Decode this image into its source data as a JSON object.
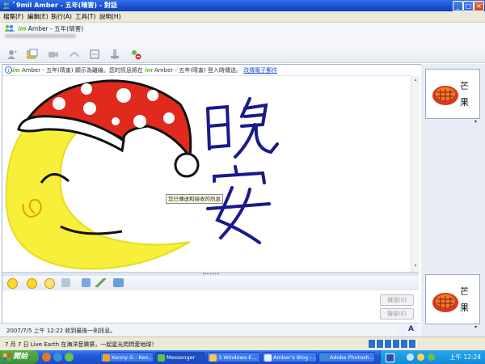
{
  "window": {
    "title": "ﾟ9mil Amber - 五年(晴害) - 對話",
    "controls": [
      "_",
      "□",
      "×"
    ]
  },
  "menu": [
    "檔案(F)",
    "編輯(E)",
    "執行(A)",
    "工具(T)",
    "說明(H)"
  ],
  "contact": {
    "name": "Amber - 五年(晴害)"
  },
  "toolbar": {
    "icons": [
      "invite-icon",
      "send-file-icon",
      "video-icon",
      "voice-icon",
      "activities-icon",
      "games-icon",
      "block-icon"
    ]
  },
  "infobar": {
    "logo": "im",
    "text": "Amber - 五年(晴害) 顯示為離線。您的訊息將在",
    "logo2": "im",
    "text2": "Amber - 五年(晴害) 登入時傳送。",
    "link": "改傳電子郵件"
  },
  "drawing": {
    "words": [
      "晚",
      "安"
    ],
    "ink_color": "#1a1a8c",
    "moon_color": "#f7ef3a",
    "hat_color": "#e02a1e"
  },
  "tooltip": "您已傳送和接收的訊息",
  "input": {
    "send_label": "傳送(S)",
    "search_label": "搜尋(E)"
  },
  "status": {
    "text": "2007/7/5 上午 12:22 收到最後一則訊息。"
  },
  "news": {
    "text": "7 月 7 日 Live Earth 在海洋音樂祭，一起星光閃閃愛地球！"
  },
  "avatars": [
    {
      "label_top": "芒",
      "label_bottom": "果"
    },
    {
      "label_top": "芒",
      "label_bottom": "果"
    }
  ],
  "taskbar": {
    "start": "開始",
    "tasks": [
      {
        "label": "Kenny G - Ken..."
      },
      {
        "label": "Messenger"
      },
      {
        "label": "3 Windows E..."
      },
      {
        "label": "Amber's Blog - ..."
      },
      {
        "label": "Adobe Photosh..."
      }
    ],
    "clock": "上午 12:24"
  }
}
